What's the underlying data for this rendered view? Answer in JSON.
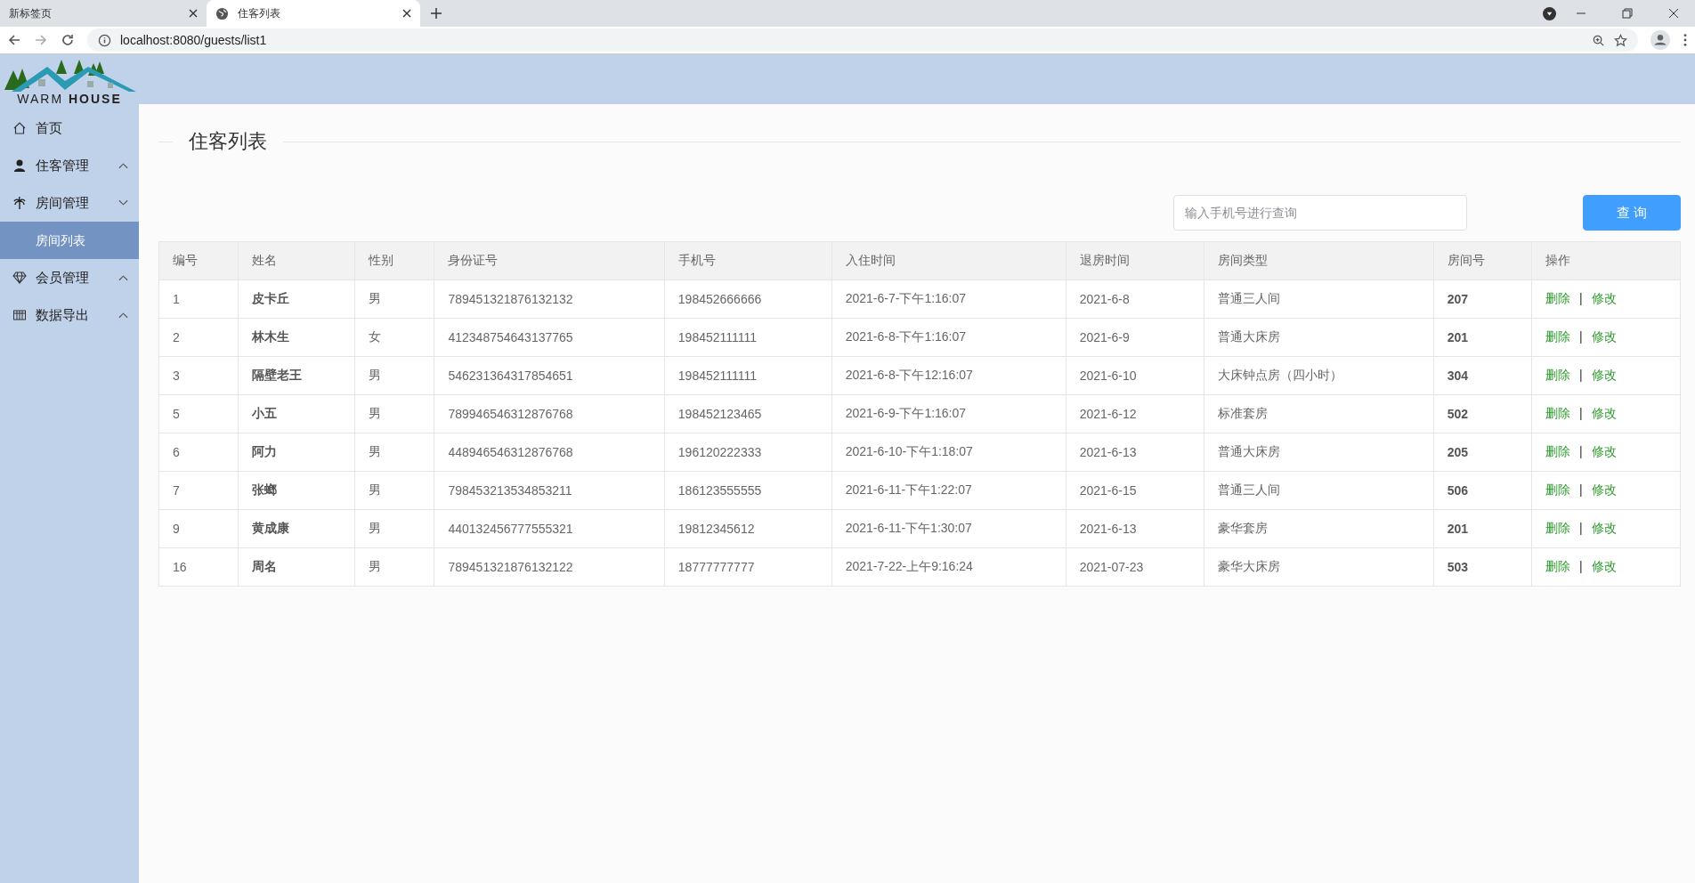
{
  "browser": {
    "tabs": [
      {
        "title": "新标签页",
        "selected": false
      },
      {
        "title": "住客列表",
        "selected": true
      }
    ],
    "url": "localhost:8080/guests/list1"
  },
  "logo": {
    "text": "WARM **HOUSE**"
  },
  "sidebar": {
    "items": [
      {
        "label": "首页",
        "kind": "home"
      },
      {
        "label": "住客管理",
        "kind": "person",
        "expanded": false
      },
      {
        "label": "房间管理",
        "kind": "palm",
        "expanded": true,
        "children": [
          {
            "label": "房间列表",
            "selected": true
          }
        ]
      },
      {
        "label": "会员管理",
        "kind": "gem",
        "expanded": false
      },
      {
        "label": "数据导出",
        "kind": "grid",
        "expanded": false
      }
    ]
  },
  "page": {
    "title": "住客列表",
    "search": {
      "placeholder": "输入手机号进行查询"
    },
    "search_button": "查 询"
  },
  "table": {
    "columns": [
      "编号",
      "姓名",
      "性别",
      "身份证号",
      "手机号",
      "入住时间",
      "退房时间",
      "房间类型",
      "房间号",
      "操作"
    ],
    "rows": [
      {
        "id": "1",
        "name": "皮卡丘",
        "gender": "男",
        "id_card": "789451321876132132",
        "phone": "198452666666",
        "check_in": "2021-6-7-下午1:16:07",
        "check_out": "2021-6-8",
        "room_type": "普通三人间",
        "room": "207",
        "actions": [
          "删除",
          "|",
          "修改"
        ]
      },
      {
        "id": "2",
        "name": "林木生",
        "gender": "女",
        "id_card": "412348754643137765",
        "phone": "198452111111",
        "check_in": "2021-6-8-下午1:16:07",
        "check_out": "2021-6-9",
        "room_type": "普通大床房",
        "room": "201",
        "actions": [
          "删除",
          "|",
          "修改"
        ]
      },
      {
        "id": "3",
        "name": "隔壁老王",
        "gender": "男",
        "id_card": "546231364317854651",
        "phone": "198452111111",
        "check_in": "2021-6-8-下午12:16:07",
        "check_out": "2021-6-10",
        "room_type": "大床钟点房（四小时）",
        "room": "304",
        "actions": [
          "删除",
          "|",
          "修改"
        ]
      },
      {
        "id": "5",
        "name": "小五",
        "gender": "男",
        "id_card": "789946546312876768",
        "phone": "198452123465",
        "check_in": "2021-6-9-下午1:16:07",
        "check_out": "2021-6-12",
        "room_type": "标准套房",
        "room": "502",
        "actions": [
          "删除",
          "|",
          "修改"
        ]
      },
      {
        "id": "6",
        "name": "阿力",
        "gender": "男",
        "id_card": "448946546312876768",
        "phone": "196120222333",
        "check_in": "2021-6-10-下午1:18:07",
        "check_out": "2021-6-13",
        "room_type": "普通大床房",
        "room": "205",
        "actions": [
          "删除",
          "|",
          "修改"
        ]
      },
      {
        "id": "7",
        "name": "张螂",
        "gender": "男",
        "id_card": "798453213534853211",
        "phone": "186123555555",
        "check_in": "2021-6-11-下午1:22:07",
        "check_out": "2021-6-15",
        "room_type": "普通三人间",
        "room": "506",
        "actions": [
          "删除",
          "|",
          "修改"
        ]
      },
      {
        "id": "9",
        "name": "黄成康",
        "gender": "男",
        "id_card": "440132456777555321",
        "phone": "19812345612",
        "check_in": "2021-6-11-下午1:30:07",
        "check_out": "2021-6-13",
        "room_type": "豪华套房",
        "room": "201",
        "actions": [
          "删除",
          "|",
          "修改"
        ]
      },
      {
        "id": "16",
        "name": "周名",
        "gender": "男",
        "id_card": "789451321876132122",
        "phone": "18777777777",
        "check_in": "2021-7-22-上午9:16:24",
        "check_out": "2021-07-23",
        "room_type": "豪华大床房",
        "room": "503",
        "actions": [
          "删除",
          "|",
          "修改"
        ]
      }
    ]
  }
}
